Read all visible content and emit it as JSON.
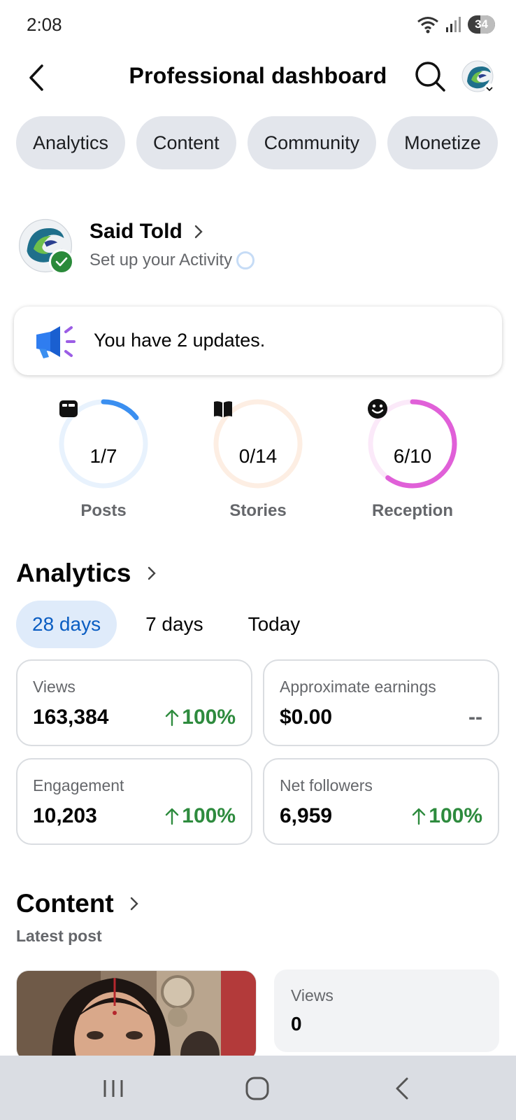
{
  "status_bar": {
    "time": "2:08",
    "battery": "34"
  },
  "header": {
    "title": "Professional dashboard"
  },
  "tabs": [
    {
      "label": "Analytics"
    },
    {
      "label": "Content"
    },
    {
      "label": "Community"
    },
    {
      "label": "Monetize"
    }
  ],
  "profile": {
    "name": "Said Told",
    "subtitle": "Set up your Activity"
  },
  "updates": {
    "text": "You have 2 updates."
  },
  "goals": [
    {
      "label": "Posts",
      "value": "1/7",
      "progress": 0.143,
      "color": "#3b8ff0",
      "track": "#e8f2fd",
      "icon": "post-icon"
    },
    {
      "label": "Stories",
      "value": "0/14",
      "progress": 0,
      "color": "#f5a56a",
      "track": "#fdeee3",
      "icon": "book-icon"
    },
    {
      "label": "Reception",
      "value": "6/10",
      "progress": 0.6,
      "color": "#e060d8",
      "track": "#fbe9f9",
      "icon": "smiley-icon"
    }
  ],
  "analytics": {
    "title": "Analytics",
    "ranges": [
      {
        "label": "28 days",
        "active": true
      },
      {
        "label": "7 days",
        "active": false
      },
      {
        "label": "Today",
        "active": false
      }
    ],
    "stats": [
      {
        "label": "Views",
        "value": "163,384",
        "change": "100%",
        "trend": "up"
      },
      {
        "label": "Approximate earnings",
        "value": "$0.00",
        "change": "--",
        "trend": "none"
      },
      {
        "label": "Engagement",
        "value": "10,203",
        "change": "100%",
        "trend": "up"
      },
      {
        "label": "Net followers",
        "value": "6,959",
        "change": "100%",
        "trend": "up"
      }
    ]
  },
  "content": {
    "title": "Content",
    "subtitle": "Latest post",
    "latest_post": {
      "views_label": "Views",
      "views_value": "0"
    }
  },
  "colors": {
    "accent_blue": "#0a5dc2",
    "positive_green": "#2e8b3e",
    "pill_bg": "#e3e6ec"
  }
}
